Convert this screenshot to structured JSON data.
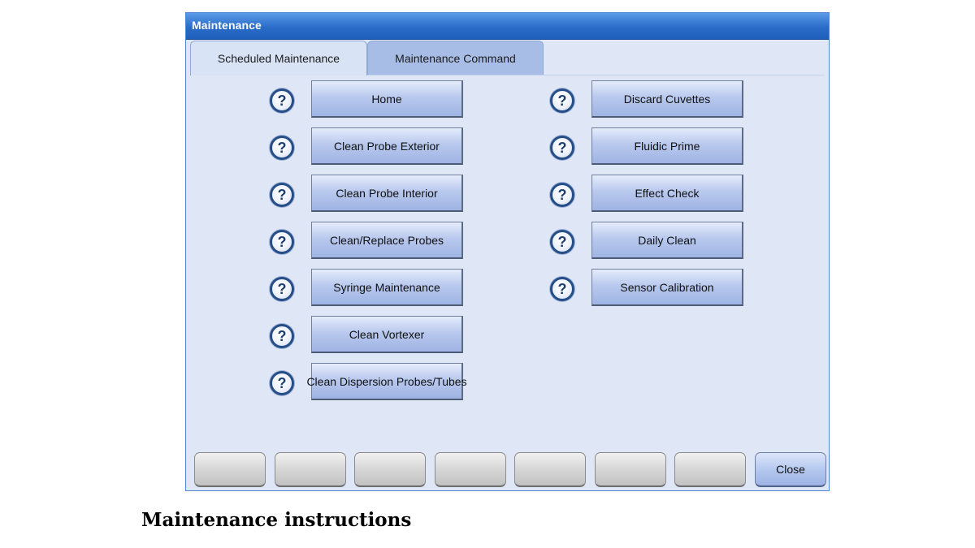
{
  "window": {
    "title": "Maintenance"
  },
  "tabs": [
    "Scheduled Maintenance",
    "Maintenance Command"
  ],
  "left_commands": [
    "Home",
    "Clean Probe Exterior",
    "Clean Probe Interior",
    "Clean/Replace Probes",
    "Syringe Maintenance",
    "Clean Vortexer",
    "Clean Dispersion Probes/Tubes"
  ],
  "right_commands": [
    "Discard Cuvettes",
    "Fluidic Prime",
    "Effect Check",
    "Daily Clean",
    "Sensor Calibration"
  ],
  "help_icon": {
    "glyph": "?",
    "icon": "help-icon"
  },
  "footer": {
    "close_label": "Close"
  },
  "caption": "Maintenance instructions"
}
